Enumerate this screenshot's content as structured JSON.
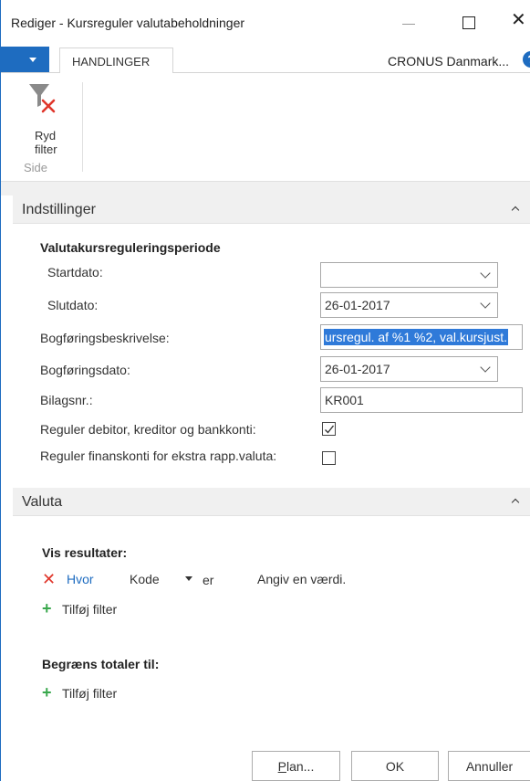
{
  "window": {
    "title": "Rediger - Kursreguler valutabeholdninger",
    "close_glyph": "✕"
  },
  "ribbon": {
    "tab_active": "HANDLINGER",
    "company": "CRONUS Danmark...",
    "help_glyph": "?",
    "clear_filter_line1": "Ryd",
    "clear_filter_line2": "filter",
    "group_label": "Side"
  },
  "settings": {
    "section_title": "Indstillinger",
    "group_title": "Valutakursreguleringsperiode",
    "start_date": {
      "label": "Startdato:",
      "value": ""
    },
    "end_date": {
      "label": "Slutdato:",
      "value": "26-01-2017"
    },
    "posting_description": {
      "label": "Bogføringsbeskrivelse:",
      "value": "ursregul. af %1 %2, val.kursjust."
    },
    "posting_date": {
      "label": "Bogføringsdato:",
      "value": "26-01-2017"
    },
    "document_no": {
      "label": "Bilagsnr.:",
      "value": "KR001"
    },
    "adjust_cust_vend_bank": {
      "label": "Reguler debitor, kreditor og bankkonti:",
      "checked": true
    },
    "adjust_gl_accounts": {
      "label": "Reguler finanskonti for ekstra rapp.valuta:",
      "checked": false
    }
  },
  "currency": {
    "section_title": "Valuta",
    "show_results_title": "Vis resultater:",
    "filter_where": "Hvor",
    "filter_field": "Kode",
    "filter_operator": "er",
    "filter_value_placeholder": "Angiv en værdi.",
    "add_filter_1": "Tilføj filter",
    "limit_totals_title": "Begræns totaler til:",
    "add_filter_2": "Tilføj filter",
    "x_glyph": "✕",
    "plus_glyph": "+"
  },
  "footer": {
    "plan_label_first": "P",
    "plan_label_rest": "lan...",
    "ok_label": "OK",
    "cancel_label": "Annuller"
  },
  "colors": {
    "accent": "#1e6cc0",
    "remove_red": "#e0362b",
    "add_green": "#3aa84d",
    "selection": "#2f7ad9"
  }
}
